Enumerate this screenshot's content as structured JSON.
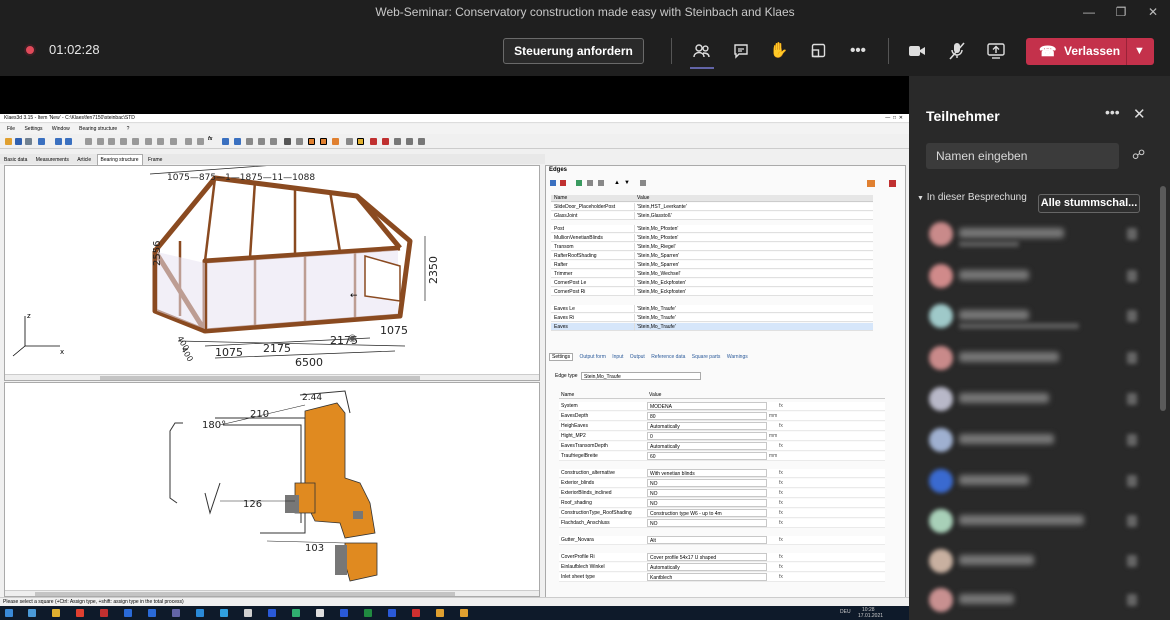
{
  "window": {
    "title": "Web-Seminar: Conservatory construction made easy with Steinbach and Klaes"
  },
  "toolbar": {
    "timer": "01:02:28",
    "request_control": "Steuerung anfordern",
    "leave": "Verlassen"
  },
  "icons": {
    "record": "record-icon",
    "people": "people-icon",
    "chat": "chat-icon",
    "raise_hand": "raise-hand-icon",
    "rooms": "breakout-rooms-icon",
    "more": "more-icon",
    "camera": "camera-icon",
    "mic_off": "mic-off-icon",
    "share": "share-screen-icon",
    "phone": "phone-hangup-icon"
  },
  "colors": {
    "leave_red": "#c4314b",
    "record_red": "#e04a5a",
    "accent": "#6264a7"
  },
  "app": {
    "title": "Klaes3d 3.15 - Item 'New' - C:\\Klaes\\fen7150\\steinbac\\STD",
    "menu": [
      "File",
      "Settings",
      "Window",
      "Bearing structure",
      "?"
    ],
    "tabs": [
      "Basic data",
      "Measurements",
      "Article",
      "Bearing structure",
      "Frame"
    ],
    "active_tab": "Bearing structure",
    "dims_top": "1075—875—1—1875—11—1088",
    "dims": {
      "d1075a": "1075",
      "d2175a": "2175",
      "d2175b": "2175",
      "d1075b": "1075",
      "d6500": "6500",
      "d2350": "2350",
      "d2556": "2556",
      "d400a": "400",
      "d400b": "400"
    },
    "axes": {
      "z": "z",
      "x": "x"
    },
    "profile_dims": {
      "p180": "180°",
      "p210": "210",
      "p244": "2.44",
      "p126": "126",
      "p103": "103"
    },
    "edges": {
      "title": "Edges",
      "col_name": "Name",
      "col_value": "Value",
      "rows": [
        {
          "name": "SlideDoor_PlaceholderPost",
          "value": "'Stein,HST_Leerkante'"
        },
        {
          "name": "GlassJoint",
          "value": "'Stein,Glasstoß'"
        },
        {
          "name": "",
          "value": ""
        },
        {
          "name": "Post",
          "value": "'Stein,Mo_Pfosten'"
        },
        {
          "name": "MullionVenetianBlinds",
          "value": "'Stein,Mo_Pfosten'"
        },
        {
          "name": "Transom",
          "value": "'Stein,Mo_Riegel'"
        },
        {
          "name": "RafterRoofShading",
          "value": "'Stein,Mo_Sparren'"
        },
        {
          "name": "Rafter",
          "value": "'Stein,Mo_Sparren'"
        },
        {
          "name": "Trimmer",
          "value": "'Stein,Mo_Wechsel'"
        },
        {
          "name": "CornerPost Le",
          "value": "'Stein,Mo_Eckpfosten'"
        },
        {
          "name": "CornerPost Ri",
          "value": "'Stein,Mo_Eckpfosten'"
        },
        {
          "name": "",
          "value": ""
        },
        {
          "name": "Eaves Le",
          "value": "'Stein,Mo_Traufe'"
        },
        {
          "name": "Eaves Ri",
          "value": "'Stein,Mo_Traufe'"
        },
        {
          "name": "Eaves",
          "value": "'Stein,Mo_Traufe'"
        }
      ]
    },
    "settings_tabs": [
      "Settings",
      "Output form",
      "Input",
      "Output",
      "Reference data",
      "Square parts",
      "Warnings"
    ],
    "edge_type_label": "Edge type",
    "edge_type_value": "Stein,Mo_Traufe",
    "settings": {
      "col_name": "Name",
      "col_value": "Value",
      "rows": [
        {
          "name": "System",
          "value": "MODENA",
          "unit": ""
        },
        {
          "name": "EavesDepth",
          "value": "80",
          "unit": "mm"
        },
        {
          "name": "HeighEaves",
          "value": "Automatically",
          "unit": ""
        },
        {
          "name": "Hight_MP2",
          "value": "0",
          "unit": "mm"
        },
        {
          "name": "EavesTransomDepth",
          "value": "Automatically",
          "unit": ""
        },
        {
          "name": "TraufriegelBreite",
          "value": "60",
          "unit": "mm"
        },
        {
          "name": "",
          "value": "",
          "unit": ""
        },
        {
          "name": "Construction_alternative",
          "value": "With venetian blinds",
          "unit": ""
        },
        {
          "name": "Exterior_blinds",
          "value": "NO",
          "unit": ""
        },
        {
          "name": "ExteriorBlinds_inclined",
          "value": "NO",
          "unit": ""
        },
        {
          "name": "Roof_shading",
          "value": "NO",
          "unit": ""
        },
        {
          "name": "ConstructionType_RoofShading",
          "value": "Construction type W6 - up to 4m",
          "unit": ""
        },
        {
          "name": "Flachdach_Anschluss",
          "value": "NO",
          "unit": ""
        },
        {
          "name": "",
          "value": "",
          "unit": ""
        },
        {
          "name": "Gutter_Novara",
          "value": "Alt",
          "unit": ""
        },
        {
          "name": "",
          "value": "",
          "unit": ""
        },
        {
          "name": "CoverProfile Ri",
          "value": "Cover profile 54x17 U shaped",
          "unit": ""
        },
        {
          "name": "Einlaufblech Winkel",
          "value": "Automatically",
          "unit": ""
        },
        {
          "name": "Inlet sheet type",
          "value": "Kantblech",
          "unit": ""
        }
      ]
    },
    "status": "Please select a square (+Ctrl: Assign type, +shift: assign type in the total process)"
  },
  "taskbar": {
    "lang": "DEU",
    "time": "10:28",
    "date": "17.01.2021"
  },
  "participants": {
    "title": "Teilnehmer",
    "search_placeholder": "Namen eingeben",
    "section": "In dieser Besprechung",
    "mute_all": "Alle stummschal...",
    "avatar_colors": [
      "#c98a8a",
      "#d08a8a",
      "#9fc9c9",
      "#c98a8a",
      "#b8b8c8",
      "#9fb0d0",
      "#3a6ad0",
      "#a8d0b8",
      "#c8b0a0",
      "#c89090"
    ]
  }
}
